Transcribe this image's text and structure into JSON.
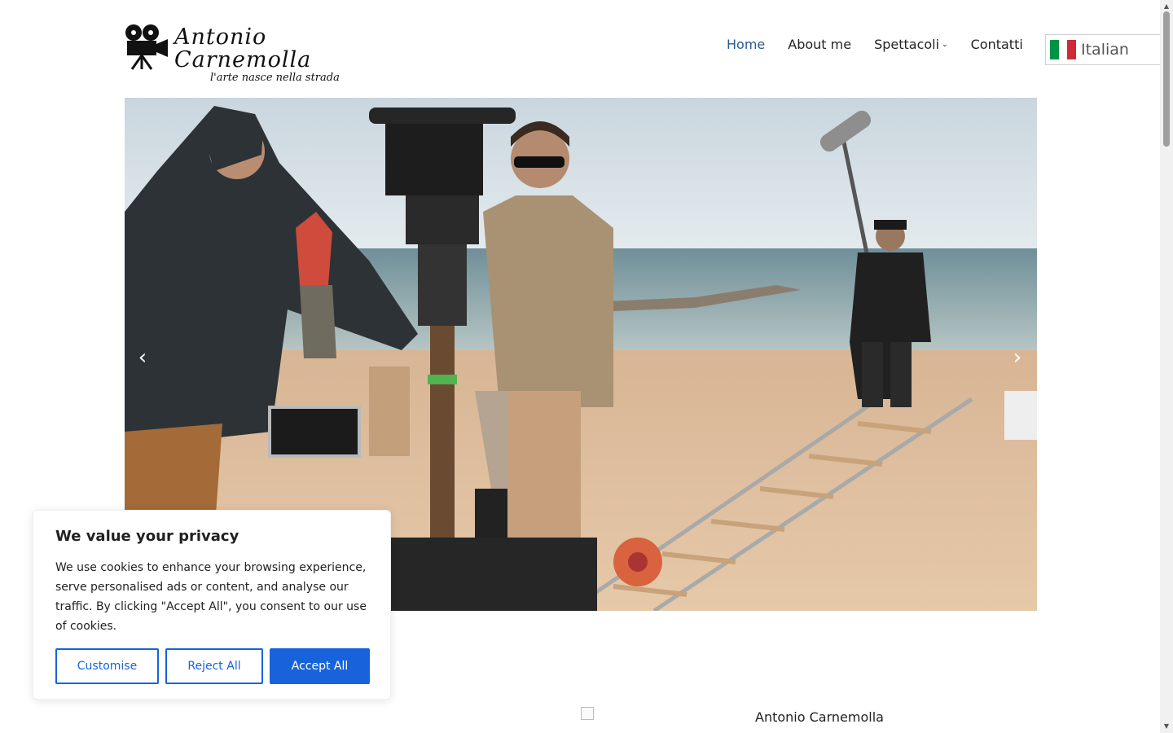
{
  "header": {
    "logo_title": "Antonio Carnemolla",
    "logo_tagline": "l'arte nasce nella strada",
    "nav": [
      {
        "label": "Home",
        "active": true
      },
      {
        "label": "About me"
      },
      {
        "label": "Spettacoli",
        "has_dropdown": true
      },
      {
        "label": "Contatti"
      }
    ],
    "language": {
      "label": "Italian",
      "flag_colors": [
        "#009246",
        "#ffffff",
        "#ce2b37"
      ]
    }
  },
  "hero": {
    "prev_icon": "chevron-left-icon",
    "next_icon": "chevron-right-icon",
    "prev_glyph": "‹",
    "next_glyph": "›"
  },
  "cookie_banner": {
    "title": "We value your privacy",
    "text": "We use cookies to enhance your browsing experience, serve personalised ads or content, and analyse our traffic. By clicking \"Accept All\", you consent to our use of cookies.",
    "customise_label": "Customise",
    "reject_label": "Reject All",
    "accept_label": "Accept All",
    "accent_color": "#1863dc"
  },
  "content": {
    "image_alt": "Antonio Carnemolla"
  },
  "colors": {
    "nav_active": "#2a5b95"
  }
}
